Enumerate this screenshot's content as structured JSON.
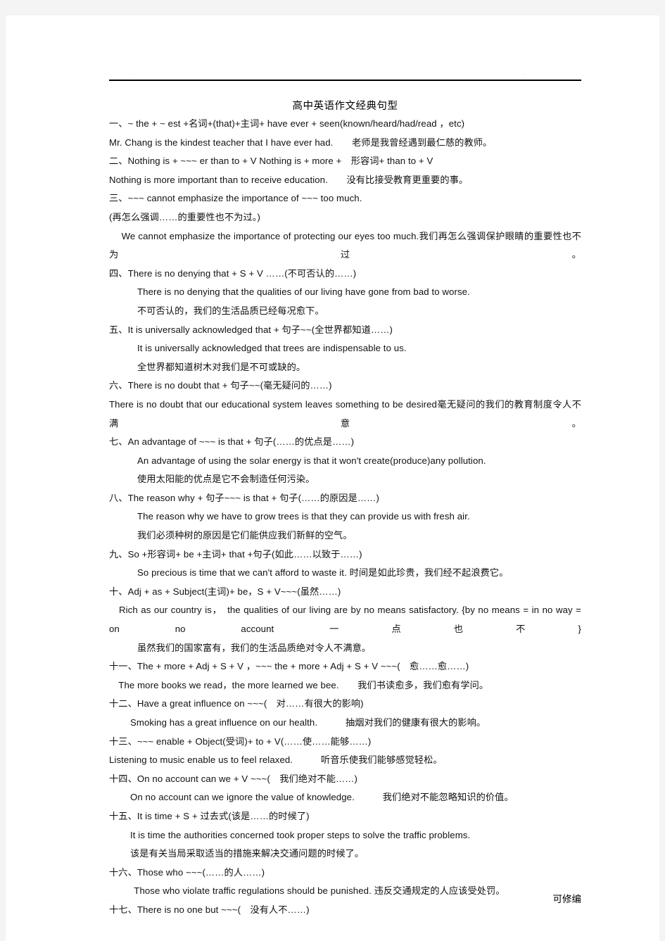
{
  "document": {
    "title": "高中英语作文经典句型",
    "header": {
      "left_mark": "·",
      "right_mark": "·"
    },
    "footer": {
      "left_mark": "·",
      "middle_mark": "·",
      "text": "可修编",
      "trailing_mark": "·"
    },
    "lines": [
      {
        "id": "pattern-1-form",
        "text": "一、~ the + ~ est +名词+(that)+主词+ have ever + seen(known/heard/had/read ，etc)",
        "indent": "i0"
      },
      {
        "id": "pattern-1-example",
        "text": "Mr. Chang is the kindest teacher that I have ever had.　　老师是我曾经遇到最仁慈的教师。",
        "indent": "i0"
      },
      {
        "id": "pattern-2-form",
        "text": "二、Nothing is + ~~~ er than to + V Nothing is + more +　形容词+ than to + V",
        "indent": "i0"
      },
      {
        "id": "pattern-2-example",
        "text": "Nothing is more important than to receive education.　　没有比接受教育更重要的事。",
        "indent": "i0"
      },
      {
        "id": "pattern-3-form",
        "text": "三、~~~ cannot emphasize the importance of ~~~ too much.",
        "indent": "i0"
      },
      {
        "id": "pattern-3-form-cn",
        "text": "(再怎么强调……的重要性也不为过。)",
        "indent": "i0"
      },
      {
        "id": "pattern-3-example",
        "text": "　 We cannot emphasize the importance of protecting our eyes too much.我们再怎么强调保护眼睛的重要性也不为过。",
        "indent": "i0",
        "justify": true
      },
      {
        "id": "pattern-4-form",
        "text": "四、There is no denying that + S + V ……(不可否认的……)",
        "indent": "i0"
      },
      {
        "id": "pattern-4-example-en",
        "text": "There is no denying that the qualities of our living have gone from bad to worse.",
        "indent": "i2"
      },
      {
        "id": "pattern-4-example-cn",
        "text": "不可否认的，我们的生活品质已经每况愈下。",
        "indent": "i2"
      },
      {
        "id": "pattern-5-form",
        "text": "五、It is universally acknowledged that + 句子~~(全世界都知道……)",
        "indent": "i0"
      },
      {
        "id": "pattern-5-example-en",
        "text": "It is universally acknowledged that trees are indispensable to us.",
        "indent": "i2"
      },
      {
        "id": "pattern-5-example-cn",
        "text": "全世界都知道树木对我们是不可或缺的。",
        "indent": "i2"
      },
      {
        "id": "pattern-6-form",
        "text": "六、There is no doubt that + 句子~~(毫无疑问的……)",
        "indent": "i0"
      },
      {
        "id": "pattern-6-example",
        "text": "There is no doubt that our educational system leaves something to be desired毫无疑问的我们的教育制度令人不满意。",
        "indent": "i0",
        "justify": true
      },
      {
        "id": "pattern-7-form",
        "text": "七、An advantage of ~~~ is that + 句子(……的优点是……)",
        "indent": "i0"
      },
      {
        "id": "pattern-7-example-en",
        "text": "An advantage of using the solar energy is that it won't create(produce)any pollution.",
        "indent": "i2"
      },
      {
        "id": "pattern-7-example-cn",
        "text": "使用太阳能的优点是它不会制造任何污染。",
        "indent": "i2"
      },
      {
        "id": "pattern-8-form",
        "text": "八、The reason why + 句子~~~ is that + 句子(……的原因是……)",
        "indent": "i0"
      },
      {
        "id": "pattern-8-example-en",
        "text": "The reason why we have to grow trees is that they can provide us with fresh air.",
        "indent": "i2"
      },
      {
        "id": "pattern-8-example-cn",
        "text": "我们必须种树的原因是它们能供应我们新鲜的空气。",
        "indent": "i2"
      },
      {
        "id": "pattern-9-form",
        "text": "九、So +形容词+ be +主词+ that +句子(如此……以致于……)",
        "indent": "i0"
      },
      {
        "id": "pattern-9-example",
        "text": "So precious is time that we can't afford to waste it. 时间是如此珍贵，我们经不起浪费它。",
        "indent": "i2"
      },
      {
        "id": "pattern-10-form",
        "text": "十、Adj + as + Subject(主词)+ be，S + V~~~(虽然……)",
        "indent": "i0"
      },
      {
        "id": "pattern-10-example-en-1",
        "text": "　Rich as our country is，　the qualities of our living are by no means satisfactory. {by no means = in no way = on no account 一点也不}",
        "indent": "i0",
        "justify": true
      },
      {
        "id": "pattern-10-example-cn",
        "text": "虽然我们的国家富有，我们的生活品质绝对令人不满意。",
        "indent": "i2"
      },
      {
        "id": "pattern-11-form",
        "text": "十一、The + more + Adj + S + V ，~~~ the + more + Adj + S + V ~~~(　愈……愈……)",
        "indent": "i0"
      },
      {
        "id": "pattern-11-example",
        "text": "　The more books we read，the more learned we bee.　　我们书读愈多，我们愈有学问。",
        "indent": "i0"
      },
      {
        "id": "pattern-12-form",
        "text": "十二、Have a great influence on ~~~(　对……有很大的影响)",
        "indent": "i0"
      },
      {
        "id": "pattern-12-example",
        "text": "Smoking has a great influence on our health.　　　抽烟对我们的健康有很大的影响。",
        "indent": "i3"
      },
      {
        "id": "pattern-13-form",
        "text": "十三、~~~ enable + Object(受词)+ to + V(……使……能够……)",
        "indent": "i0"
      },
      {
        "id": "pattern-13-example",
        "text": "Listening to music enable us to feel relaxed.　　　听音乐使我们能够感觉轻松。",
        "indent": "i0"
      },
      {
        "id": "pattern-14-form",
        "text": "十四、On no account can we + V ~~~(　我们绝对不能……)",
        "indent": "i0"
      },
      {
        "id": "pattern-14-example",
        "text": "On no account can we ignore the value of knowledge.　　　我们绝对不能忽略知识的价值。",
        "indent": "i3"
      },
      {
        "id": "pattern-15-form",
        "text": "十五、It is time + S + 过去式(该是……的时候了)",
        "indent": "i0"
      },
      {
        "id": "pattern-15-example-en",
        "text": "It is time the authorities concerned took proper steps to solve the traffic problems.",
        "indent": "i3"
      },
      {
        "id": "pattern-15-example-cn",
        "text": "该是有关当局采取适当的措施来解决交通问题的时候了。",
        "indent": "i3"
      },
      {
        "id": "pattern-16-form",
        "text": "十六、Those who ~~~(……的人……)",
        "indent": "i0"
      },
      {
        "id": "pattern-16-example",
        "text": "　Those who violate traffic regulations should be punished. 违反交通规定的人应该受处罚。",
        "indent": "i4"
      },
      {
        "id": "pattern-17-form",
        "text": "十七、There is no one but ~~~(　没有人不……)",
        "indent": "i0"
      }
    ]
  }
}
